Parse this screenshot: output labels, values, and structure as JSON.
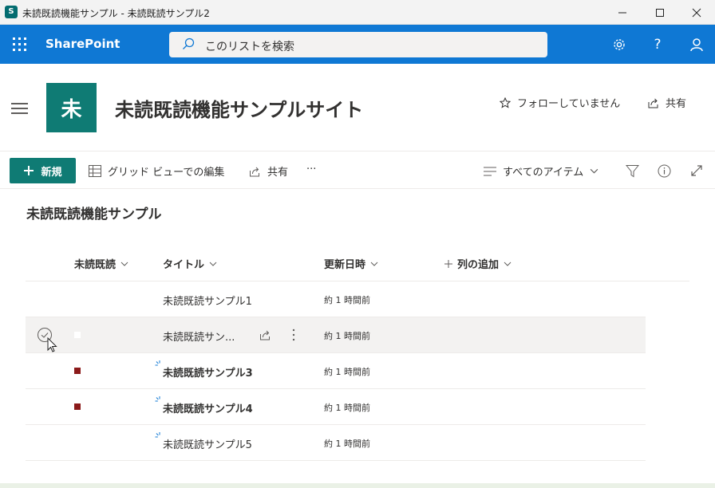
{
  "window": {
    "title": "未読既読機能サンプル - 未読既読サンプル2",
    "app_icon_letter": "S",
    "controls": [
      "minimize",
      "maximize",
      "close"
    ]
  },
  "suite": {
    "brand": "SharePoint",
    "search_placeholder": "このリストを検索",
    "icons": [
      "waffle-icon",
      "search-icon",
      "gear-icon",
      "help-icon",
      "person-icon"
    ],
    "help_glyph": "?",
    "accent": "#0f78d4"
  },
  "site": {
    "logo_letter": "未",
    "title": "未読既読機能サンプルサイト",
    "follow_label": "フォローしていません",
    "share_label": "共有",
    "logo_color": "#0f7b74"
  },
  "commandbar": {
    "new_label": "新規",
    "grid_edit_label": "グリッド ビューでの編集",
    "share_label": "共有",
    "more_label": "···",
    "view_label": "すべてのアイテム"
  },
  "list": {
    "title": "未読既読機能サンプル",
    "columns": {
      "unread": "未読既読",
      "title": "タイトル",
      "modified": "更新日時",
      "add_column": "列の追加"
    },
    "rows": [
      {
        "title": "未読既読サンプル1",
        "modified": "約 1 時間前",
        "unread": "none",
        "is_new": false,
        "bold": false,
        "selected": false
      },
      {
        "title": "未読既読サン...",
        "modified": "約 1 時間前",
        "unread": "read",
        "is_new": false,
        "bold": false,
        "selected": true
      },
      {
        "title": "未読既読サンプル3",
        "modified": "約 1 時間前",
        "unread": "unread",
        "is_new": true,
        "bold": true,
        "selected": false
      },
      {
        "title": "未読既読サンプル4",
        "modified": "約 1 時間前",
        "unread": "unread",
        "is_new": true,
        "bold": true,
        "selected": false
      },
      {
        "title": "未読既読サンプル5",
        "modified": "約 1 時間前",
        "unread": "none",
        "is_new": true,
        "bold": false,
        "selected": false
      }
    ],
    "unread_color": "#8b1a1a",
    "new_color": "#0f78d4"
  }
}
